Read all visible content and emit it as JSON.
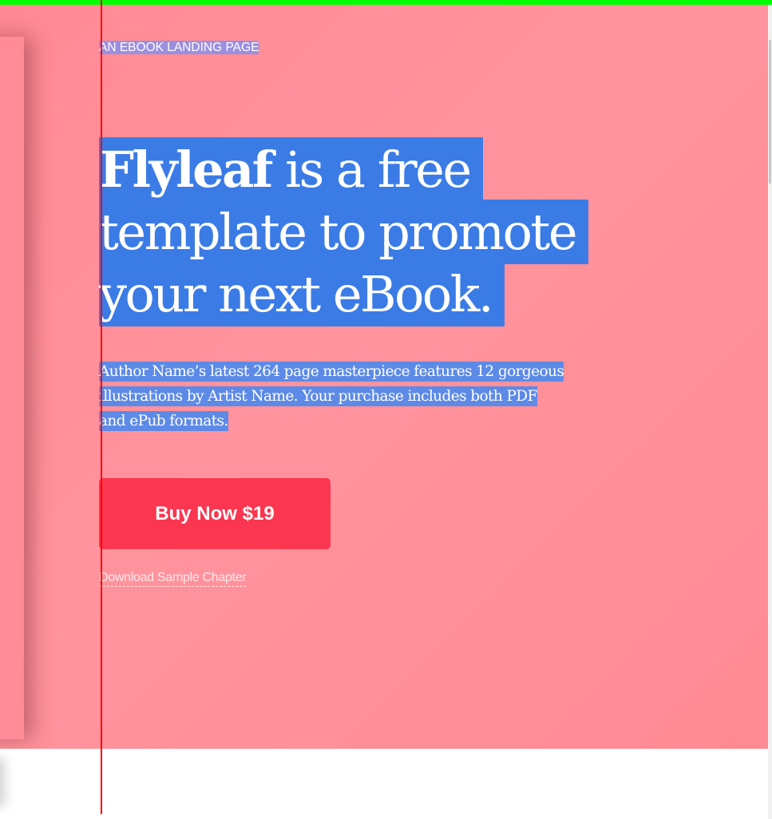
{
  "hero": {
    "eyebrow": "AN EBOOK LANDING PAGE",
    "headline_brand": "Flyleaf",
    "headline_line1_rest": " is a free",
    "headline_line2": "template to promote",
    "headline_line3": "your next eBook.",
    "lede_line1": "Author Name’s latest 264 page masterpiece features 12 gorgeous",
    "lede_line2": "illustrations by Artist Name. Your purchase includes both PDF",
    "lede_line3": "and ePub formats.",
    "buy_button_label": "Buy Now $19",
    "sample_link_label": "Download Sample Chapter"
  },
  "colors": {
    "hero_background": "#ff8a95",
    "button": "#fa3650",
    "selection_highlight": "#3b7be6",
    "top_bar": "#00ff00",
    "guide_line": "#ff0000"
  }
}
